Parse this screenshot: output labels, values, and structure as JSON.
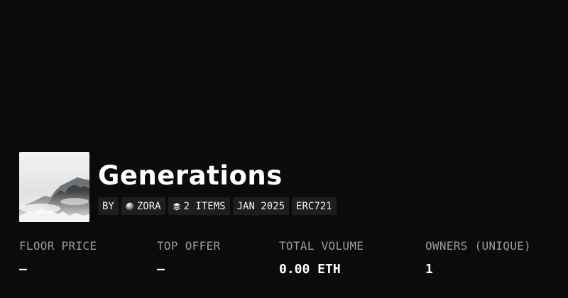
{
  "collection": {
    "title": "Generations",
    "meta": {
      "by_label": "BY",
      "creator": "ZORA",
      "creator_icon": "zora-orb-icon",
      "items": "2 ITEMS",
      "items_icon": "layers-icon",
      "date": "JAN 2025",
      "standard": "ERC721"
    },
    "thumbnail": "misty-mountain-image"
  },
  "stats": [
    {
      "label": "FLOOR PRICE",
      "value": "–"
    },
    {
      "label": "TOP OFFER",
      "value": "–"
    },
    {
      "label": "TOTAL VOLUME",
      "value": "0.00 ETH"
    },
    {
      "label": "OWNERS (UNIQUE)",
      "value": "1"
    }
  ],
  "colors": {
    "background": "#0b0b0c",
    "chip_background": "#1e1e20",
    "label": "#9b9ba0",
    "text": "#ffffff"
  }
}
